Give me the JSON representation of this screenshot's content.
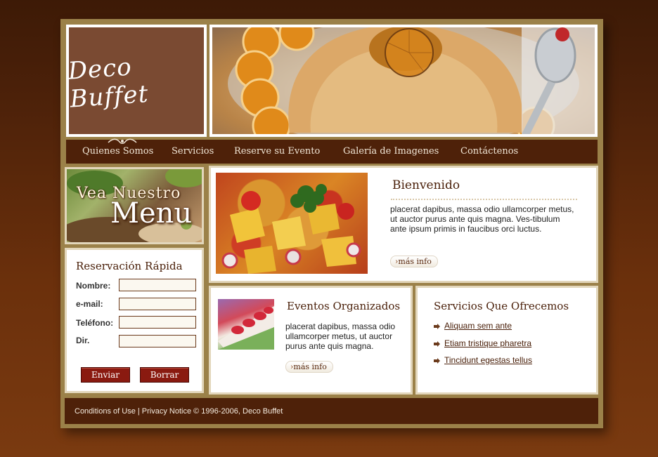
{
  "logo": {
    "text": "Deco Buffet"
  },
  "nav": [
    {
      "label": "Quienes Somos"
    },
    {
      "label": "Servicios"
    },
    {
      "label": "Reserve su Evento"
    },
    {
      "label": "Galería de Imagenes"
    },
    {
      "label": "Contáctenos"
    }
  ],
  "menu_promo": {
    "line1": "Vea Nuestro",
    "line2": "Menu"
  },
  "reservation": {
    "title": "Reservación Rápida",
    "fields": [
      {
        "label": "Nombre:",
        "value": ""
      },
      {
        "label": "e-mail:",
        "value": ""
      },
      {
        "label": "Teléfono:",
        "value": ""
      },
      {
        "label": "Dir.",
        "value": ""
      }
    ],
    "submit_label": "Enviar",
    "reset_label": "Borrar"
  },
  "welcome": {
    "title": "Bienvenido",
    "body": "placerat dapibus, massa odio ullamcorper metus, ut auctor purus ante quis magna. Ves-tibulum ante ipsum primis in faucibus orci luctus.",
    "more_label": "más info"
  },
  "events": {
    "title": "Eventos Organizados",
    "body": "placerat dapibus, massa odio ullamcorper metus, ut auctor purus ante quis magna.",
    "more_label": "más info"
  },
  "services": {
    "title": "Servicios Que Ofrecemos",
    "items": [
      {
        "label": "Aliquam sem ante"
      },
      {
        "label": "Etiam tristique pharetra"
      },
      {
        "label": "Tincidunt egestas tellus"
      }
    ]
  },
  "footer": {
    "text": "Conditions of Use | Privacy Notice © 1996-2006, Deco Buffet"
  },
  "colors": {
    "brown_dark": "#4e2109",
    "gold_border": "#9b8149",
    "logo_bg": "#7a4a32",
    "button_red": "#8a1a10"
  }
}
